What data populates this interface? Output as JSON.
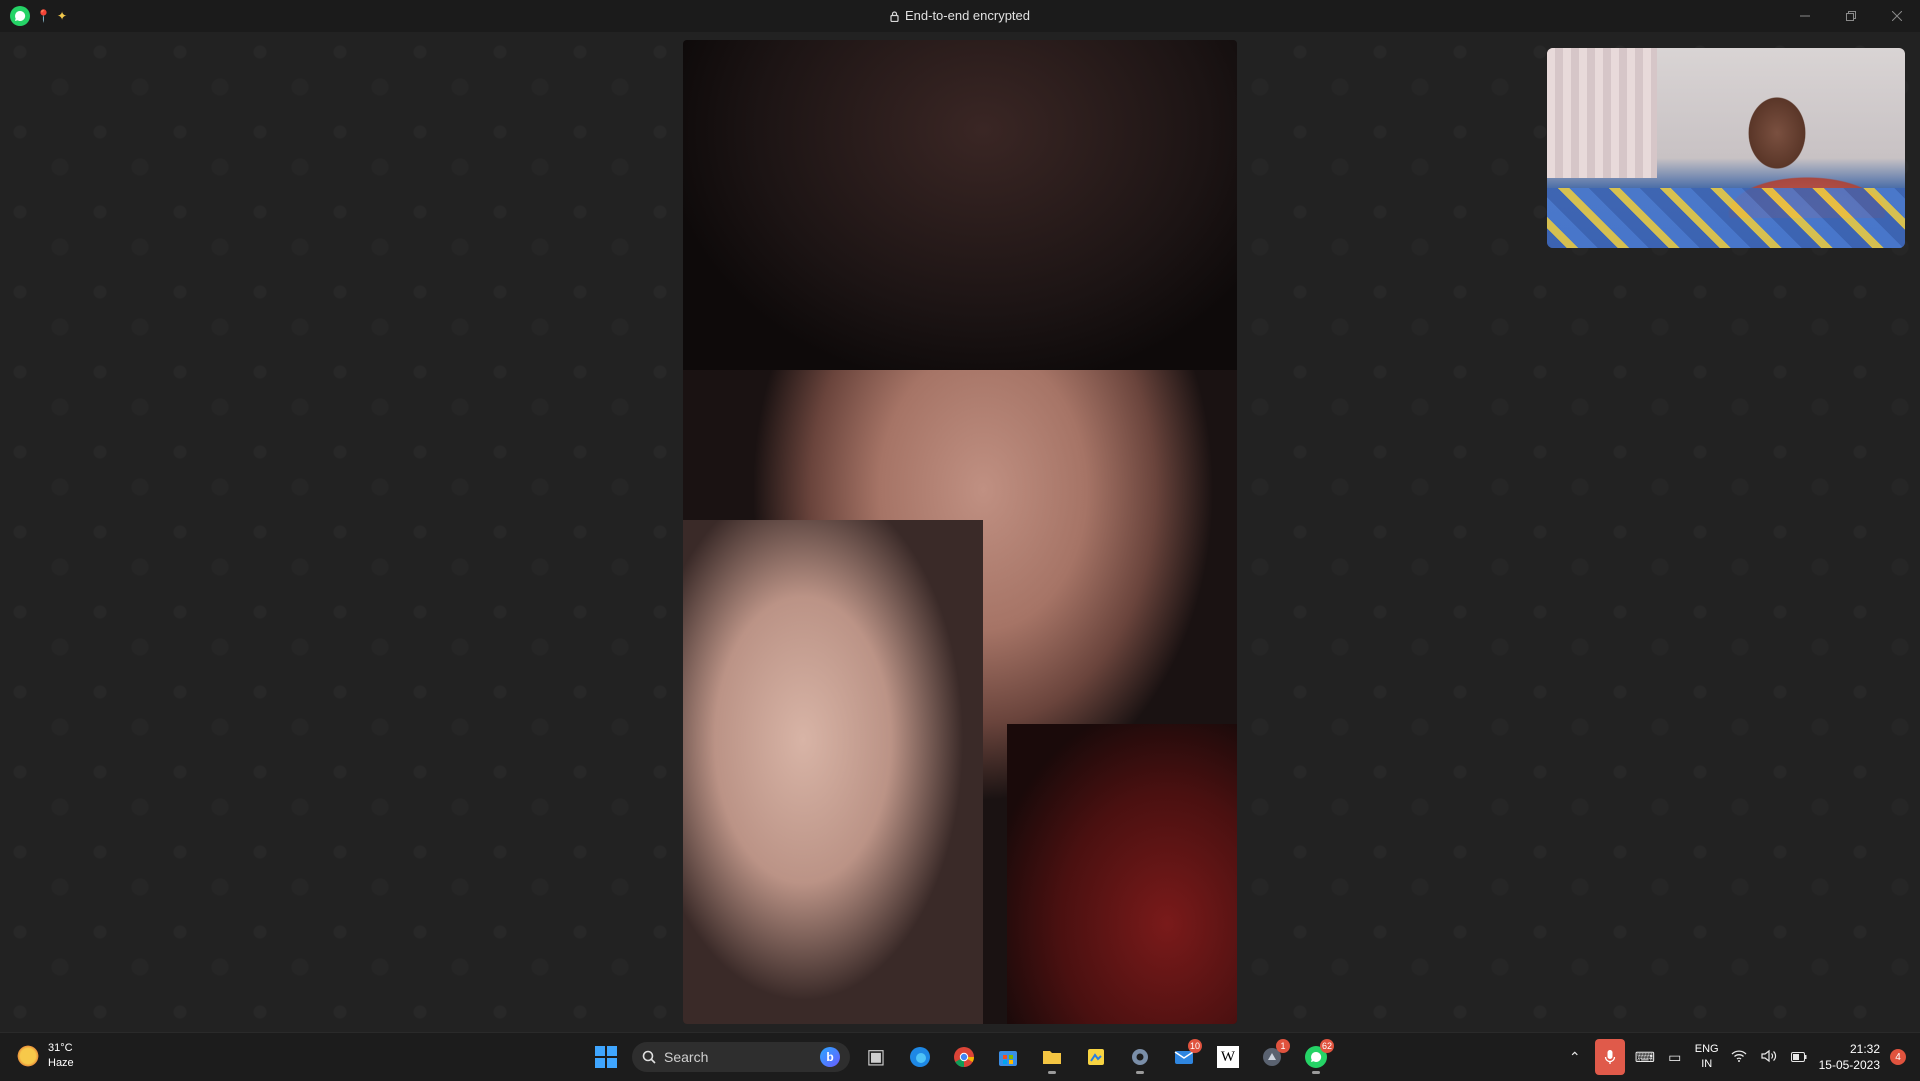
{
  "titlebar": {
    "title": "End-to-end encrypted",
    "app_icon": "whatsapp-icon",
    "controls": [
      "minimize",
      "restore",
      "close"
    ]
  },
  "call": {
    "remote_video": "remote-participant-video",
    "self_video": "self-preview-video"
  },
  "taskbar": {
    "weather": {
      "temp": "31°C",
      "condition": "Haze"
    },
    "search": {
      "placeholder": "Search"
    },
    "apps": [
      {
        "name": "task-view",
        "badge": ""
      },
      {
        "name": "edge",
        "badge": ""
      },
      {
        "name": "chrome",
        "badge": ""
      },
      {
        "name": "store",
        "badge": ""
      },
      {
        "name": "file-explorer",
        "badge": ""
      },
      {
        "name": "sticky-notes",
        "badge": ""
      },
      {
        "name": "settings",
        "badge": ""
      },
      {
        "name": "mail",
        "badge": "10"
      },
      {
        "name": "wikipedia",
        "badge": ""
      },
      {
        "name": "app-with-notification",
        "badge": "1"
      },
      {
        "name": "whatsapp",
        "badge": "62"
      }
    ],
    "tray": {
      "lang_top": "ENG",
      "lang_bottom": "IN",
      "time": "21:32",
      "date": "15-05-2023",
      "notifications": "4"
    }
  }
}
